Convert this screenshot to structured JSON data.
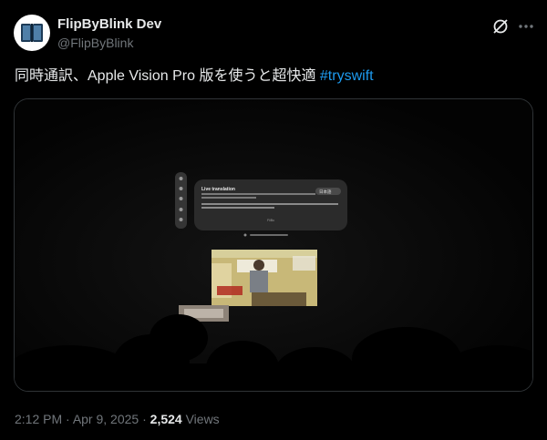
{
  "author": {
    "display_name": "FlipByBlink Dev",
    "handle": "@FlipByBlink"
  },
  "tweet": {
    "text": "同時通訳、Apple Vision Pro 版を使うと超快適 ",
    "hashtag": "#tryswift"
  },
  "media": {
    "overlay_title": "Live translation",
    "overlay_language": "日本語",
    "overlay_footer": "FliBo"
  },
  "meta": {
    "time": "2:12 PM",
    "separator": " · ",
    "date": "Apr 9, 2025",
    "separator2": " · ",
    "views_count": "2,524",
    "views_label": " Views"
  },
  "colors": {
    "background": "#000000",
    "text": "#e7e9ea",
    "muted": "#71767b",
    "link": "#1d9bf0",
    "border": "#2f3336"
  },
  "icons": {
    "grok": "grok-icon",
    "more": "more-icon"
  }
}
